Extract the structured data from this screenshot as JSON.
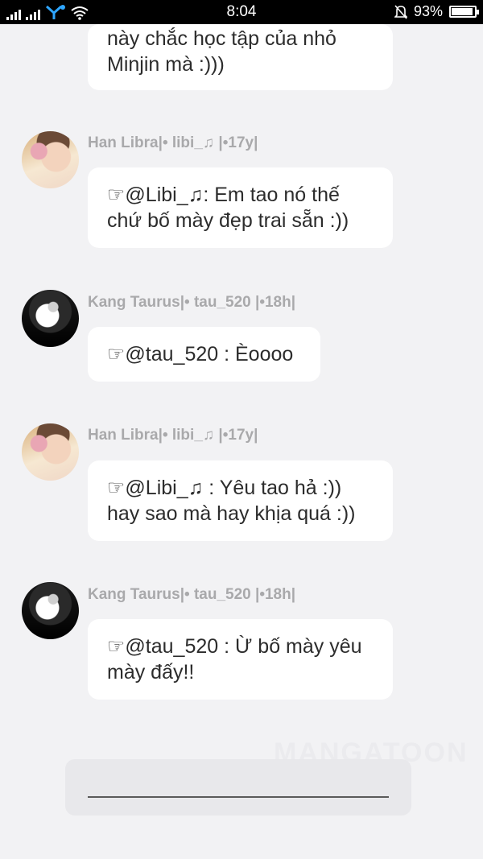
{
  "status_bar": {
    "time": "8:04",
    "battery_percent": "93%",
    "battery_level": 0.93,
    "icons": [
      "signal-icon",
      "signal-icon",
      "network-icon",
      "wifi-icon",
      "mute-icon",
      "battery-icon"
    ]
  },
  "messages": [
    {
      "type": "bubble",
      "text": "này chắc học tập của nhỏ\nMinjin mà :)))"
    },
    {
      "type": "user",
      "name": "Han Libra|• libi_♫ |•17y|"
    },
    {
      "type": "bubble",
      "text": "☞@Libi_♫: Em tao nó thế\nchứ bố mày đẹp trai sẵn :))"
    },
    {
      "type": "user",
      "name": "Kang Taurus|• tau_520 |•18h|"
    },
    {
      "type": "bubble",
      "text": "☞@tau_520 : Èoooo"
    },
    {
      "type": "user",
      "name": "Han Libra|• libi_♫ |•17y|"
    },
    {
      "type": "bubble",
      "text": "☞@Libi_♫ : Yêu tao hả :))\nhay sao mà hay khịa quá :))"
    },
    {
      "type": "user",
      "name": "Kang Taurus|• tau_520 |•18h|"
    },
    {
      "type": "bubble",
      "text": "☞@tau_520 : Ừ bố mày yêu\nmày đấy!!"
    }
  ],
  "watermark": "MANGATOON",
  "colors": {
    "background": "#f2f2f4",
    "bubble": "#ffffff",
    "username": "#a9a9ab",
    "text": "#2c2c2c"
  }
}
